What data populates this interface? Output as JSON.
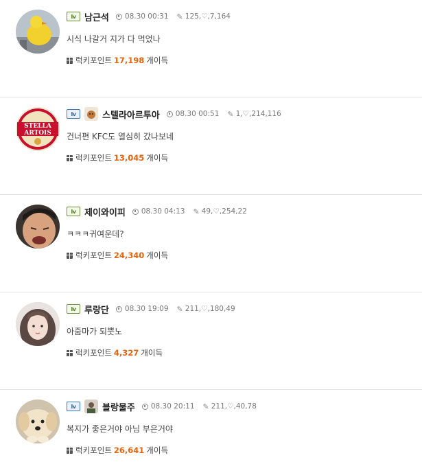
{
  "colors": {
    "points_accent": "#e8620a",
    "divider": "#e2e2e2"
  },
  "comments": [
    {
      "level_badge": "lv",
      "nickname": "남근석",
      "time": "08.30 00:31",
      "stats": "125,♡,7,164",
      "text": "시식 나갈거 지가 다 먹었나",
      "points_label": "럭키포인트",
      "points_value": "17,198",
      "points_suffix": "개이득",
      "avatar_icon": "yellow-duck-avatar"
    },
    {
      "level_badge": "lv",
      "nickname": "스텔라아르투아",
      "time": "08.30 00:51",
      "stats": "1,♡,214,116",
      "text": "건너편 KFC도 열심히 갔나보네",
      "points_label": "럭키포인트",
      "points_value": "13,045",
      "points_suffix": "개이득",
      "avatar_icon": "stella-artois-logo-avatar",
      "avatar_logo_text": [
        "STELLA",
        "ARTOIS"
      ]
    },
    {
      "level_badge": "lv",
      "nickname": "제이와이피",
      "time": "08.30 04:13",
      "stats": "49,♡,254,22",
      "text": "ㅋㅋㅋ귀여운데?",
      "points_label": "럭키포인트",
      "points_value": "24,340",
      "points_suffix": "개이득",
      "avatar_icon": "man-face-avatar"
    },
    {
      "level_badge": "lv",
      "nickname": "루랑단",
      "time": "08.30 19:09",
      "stats": "211,♡,180,49",
      "text": "아줌마가 되뿟노",
      "points_label": "럭키포인트",
      "points_value": "4,327",
      "points_suffix": "개이득",
      "avatar_icon": "woman-face-avatar"
    },
    {
      "level_badge": "lv",
      "nickname": "블랑물주",
      "time": "08.30 20:11",
      "stats": "211,♡,40,78",
      "text": "복지가 좋은거야 아님 부은거야",
      "points_label": "럭키포인트",
      "points_value": "26,641",
      "points_suffix": "개이득",
      "avatar_icon": "puppy-avatar"
    }
  ]
}
